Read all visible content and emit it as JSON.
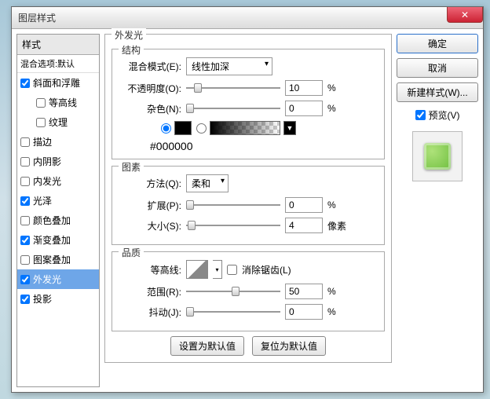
{
  "window": {
    "title": "图层样式"
  },
  "sidebar": {
    "header": "样式",
    "blend_default": "混合选项:默认",
    "items": [
      {
        "label": "斜面和浮雕",
        "checked": true,
        "indent": false
      },
      {
        "label": "等高线",
        "checked": false,
        "indent": true
      },
      {
        "label": "纹理",
        "checked": false,
        "indent": true
      },
      {
        "label": "描边",
        "checked": false,
        "indent": false
      },
      {
        "label": "内阴影",
        "checked": false,
        "indent": false
      },
      {
        "label": "内发光",
        "checked": false,
        "indent": false
      },
      {
        "label": "光泽",
        "checked": true,
        "indent": false
      },
      {
        "label": "颜色叠加",
        "checked": false,
        "indent": false
      },
      {
        "label": "渐变叠加",
        "checked": true,
        "indent": false
      },
      {
        "label": "图案叠加",
        "checked": false,
        "indent": false
      },
      {
        "label": "外发光",
        "checked": true,
        "indent": false,
        "selected": true
      },
      {
        "label": "投影",
        "checked": true,
        "indent": false
      }
    ]
  },
  "main": {
    "group_title": "外发光",
    "structure": {
      "title": "结构",
      "blend_mode_label": "混合模式(E):",
      "blend_mode_value": "线性加深",
      "opacity_label": "不透明度(O):",
      "opacity_value": "10",
      "opacity_unit": "%",
      "noise_label": "杂色(N):",
      "noise_value": "0",
      "noise_unit": "%",
      "hex": "#000000"
    },
    "elements": {
      "title": "图素",
      "technique_label": "方法(Q):",
      "technique_value": "柔和",
      "spread_label": "扩展(P):",
      "spread_value": "0",
      "spread_unit": "%",
      "size_label": "大小(S):",
      "size_value": "4",
      "size_unit": "像素"
    },
    "quality": {
      "title": "品质",
      "contour_label": "等高线:",
      "antialias_label": "消除锯齿(L)",
      "range_label": "范围(R):",
      "range_value": "50",
      "range_unit": "%",
      "jitter_label": "抖动(J):",
      "jitter_value": "0",
      "jitter_unit": "%"
    },
    "defaults": {
      "set": "设置为默认值",
      "reset": "复位为默认值"
    }
  },
  "right": {
    "ok": "确定",
    "cancel": "取消",
    "new_style": "新建样式(W)...",
    "preview": "预览(V)"
  }
}
